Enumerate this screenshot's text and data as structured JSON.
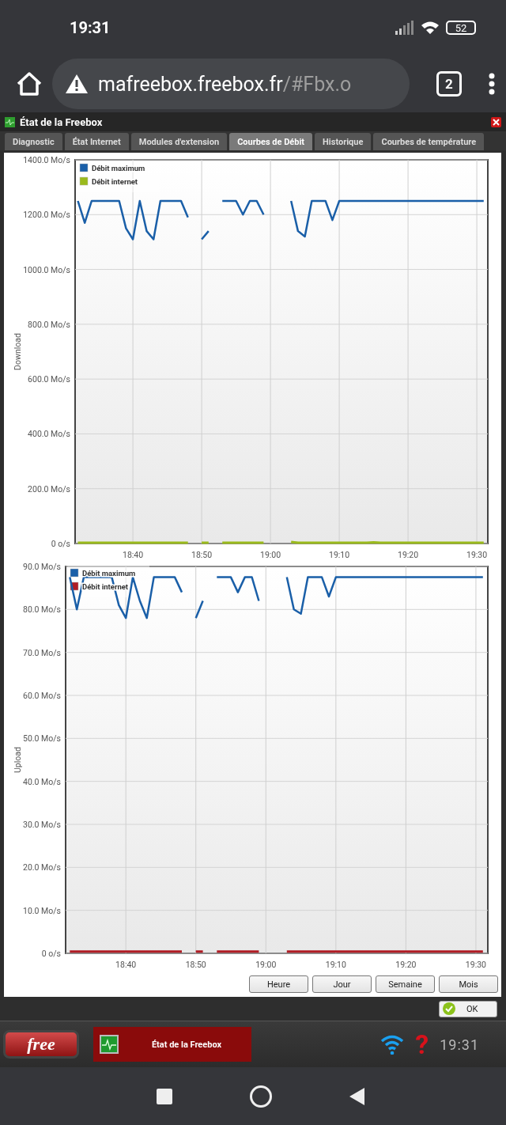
{
  "status_bar": {
    "time": "19:31",
    "battery": "52"
  },
  "browser": {
    "url_host": "mafreebox.freebox.fr",
    "url_rest": "/#Fbx.o",
    "tab_count": "2"
  },
  "window": {
    "title": "État de la Freebox",
    "tabs": [
      {
        "label": "Diagnostic",
        "selected": false
      },
      {
        "label": "État Internet",
        "selected": false
      },
      {
        "label": "Modules d'extension",
        "selected": false
      },
      {
        "label": "Courbes de Débit",
        "selected": true
      },
      {
        "label": "Historique",
        "selected": false
      },
      {
        "label": "Courbes de température",
        "selected": false
      }
    ],
    "charts": [
      {
        "chart_data": {
          "type": "line",
          "grid": true,
          "legend": true,
          "ylabel": "Download",
          "categories": [
            null,
            null,
            null,
            null,
            null,
            null,
            null,
            null,
            "18:40",
            null,
            null,
            null,
            null,
            null,
            null,
            null,
            null,
            null,
            "18:50",
            null,
            null,
            null,
            null,
            null,
            null,
            null,
            null,
            null,
            "19:00",
            null,
            null,
            null,
            null,
            null,
            null,
            null,
            null,
            null,
            "19:10",
            null,
            null,
            null,
            null,
            null,
            null,
            null,
            null,
            null,
            "19:20",
            null,
            null,
            null,
            null,
            null,
            null,
            null,
            null,
            null,
            "19:30",
            null
          ],
          "ylim": [
            0,
            1400
          ],
          "yticks": [
            {
              "value": 0,
              "label": "0 o/s"
            },
            {
              "value": 200,
              "label": "200.0 Mo/s"
            },
            {
              "value": 400,
              "label": "400.0 Mo/s"
            },
            {
              "value": 600,
              "label": "600.0 Mo/s"
            },
            {
              "value": 800,
              "label": "800.0 Mo/s"
            },
            {
              "value": 1000,
              "label": "1000.0 Mo/s"
            },
            {
              "value": 1200,
              "label": "1200.0 Mo/s"
            },
            {
              "value": 1400,
              "label": "1400.0 Mo/s"
            }
          ],
          "series": [
            {
              "name": "Débit maximum",
              "color": "#1a5fa8",
              "values": [
                1250,
                1170,
                1250,
                1250,
                1250,
                1250,
                1250,
                1150,
                1110,
                1250,
                1140,
                1110,
                1250,
                1250,
                1250,
                1250,
                1190,
                null,
                1110,
                1140,
                null,
                1250,
                1250,
                1250,
                1200,
                1250,
                1250,
                1200,
                null,
                null,
                null,
                1250,
                1140,
                1120,
                1250,
                1250,
                1250,
                1180,
                1250,
                1250,
                1250,
                1250,
                1250,
                1250,
                1250,
                1250,
                1250,
                1250,
                1250,
                1250,
                1250,
                1250,
                1250,
                1250,
                1250,
                1250,
                1250,
                1250,
                1250,
                1250
              ]
            },
            {
              "name": "Débit internet",
              "color": "#9aba1c",
              "values": [
                3,
                3,
                3,
                3,
                3,
                3,
                3,
                3,
                3,
                3,
                3,
                3,
                3,
                3,
                3,
                3,
                3,
                null,
                3,
                3,
                null,
                3,
                3,
                3,
                3,
                3,
                3,
                3,
                null,
                null,
                null,
                6,
                3,
                3,
                3,
                3,
                3,
                3,
                3,
                3,
                3,
                3,
                3,
                4,
                3,
                3,
                3,
                3,
                3,
                3,
                3,
                3,
                3,
                3,
                3,
                3,
                3,
                3,
                3,
                3
              ]
            }
          ]
        }
      },
      {
        "chart_data": {
          "type": "line",
          "grid": true,
          "legend": true,
          "ylabel": "Upload",
          "categories": [
            null,
            null,
            null,
            null,
            null,
            null,
            null,
            null,
            "18:40",
            null,
            null,
            null,
            null,
            null,
            null,
            null,
            null,
            null,
            "18:50",
            null,
            null,
            null,
            null,
            null,
            null,
            null,
            null,
            null,
            "19:00",
            null,
            null,
            null,
            null,
            null,
            null,
            null,
            null,
            null,
            "19:10",
            null,
            null,
            null,
            null,
            null,
            null,
            null,
            null,
            null,
            "19:20",
            null,
            null,
            null,
            null,
            null,
            null,
            null,
            null,
            null,
            "19:30",
            null
          ],
          "ylim": [
            0,
            90
          ],
          "yticks": [
            {
              "value": 0,
              "label": "0 o/s"
            },
            {
              "value": 10,
              "label": "10.0 Mo/s"
            },
            {
              "value": 20,
              "label": "20.0 Mo/s"
            },
            {
              "value": 30,
              "label": "30.0 Mo/s"
            },
            {
              "value": 40,
              "label": "40.0 Mo/s"
            },
            {
              "value": 50,
              "label": "50.0 Mo/s"
            },
            {
              "value": 60,
              "label": "60.0 Mo/s"
            },
            {
              "value": 70,
              "label": "70.0 Mo/s"
            },
            {
              "value": 80,
              "label": "80.0 Mo/s"
            },
            {
              "value": 90,
              "label": "90.0 Mo/s"
            }
          ],
          "series": [
            {
              "name": "Débit maximum",
              "color": "#1a5fa8",
              "values": [
                87.5,
                80,
                87.5,
                87.5,
                87.5,
                87.5,
                87.5,
                81,
                78,
                87.5,
                82,
                78,
                87.5,
                87.5,
                87.5,
                87.5,
                84,
                null,
                78,
                82,
                null,
                87.5,
                87.5,
                87.5,
                84,
                87.5,
                87.5,
                82,
                null,
                null,
                null,
                87.5,
                80,
                79,
                87.5,
                87.5,
                87.5,
                83,
                87.5,
                87.5,
                87.5,
                87.5,
                87.5,
                87.5,
                87.5,
                87.5,
                87.5,
                87.5,
                87.5,
                87.5,
                87.5,
                87.5,
                87.5,
                87.5,
                87.5,
                87.5,
                87.5,
                87.5,
                87.5,
                87.5
              ]
            },
            {
              "name": "Débit internet",
              "color": "#b01c24",
              "values": [
                0.4,
                0.4,
                0.4,
                0.4,
                0.4,
                0.4,
                0.4,
                0.4,
                0.4,
                0.4,
                0.4,
                0.4,
                0.4,
                0.4,
                0.4,
                0.4,
                0.4,
                null,
                0.4,
                0.4,
                null,
                0.4,
                0.4,
                0.4,
                0.4,
                0.4,
                0.4,
                0.4,
                null,
                null,
                null,
                0.4,
                0.4,
                0.4,
                0.4,
                0.4,
                0.4,
                0.4,
                0.4,
                0.4,
                0.4,
                0.4,
                0.4,
                0.4,
                0.4,
                0.4,
                0.4,
                0.4,
                0.4,
                0.4,
                0.4,
                0.4,
                0.4,
                0.4,
                0.4,
                0.4,
                0.4,
                0.4,
                0.4,
                0.4
              ]
            }
          ]
        }
      }
    ],
    "range_buttons": [
      "Heure",
      "Jour",
      "Semaine",
      "Mois"
    ],
    "ok_button": "OK"
  },
  "taskbar": {
    "logo": "free",
    "task": "État de la Freebox",
    "help_mark": "?",
    "clock": "19:31"
  }
}
